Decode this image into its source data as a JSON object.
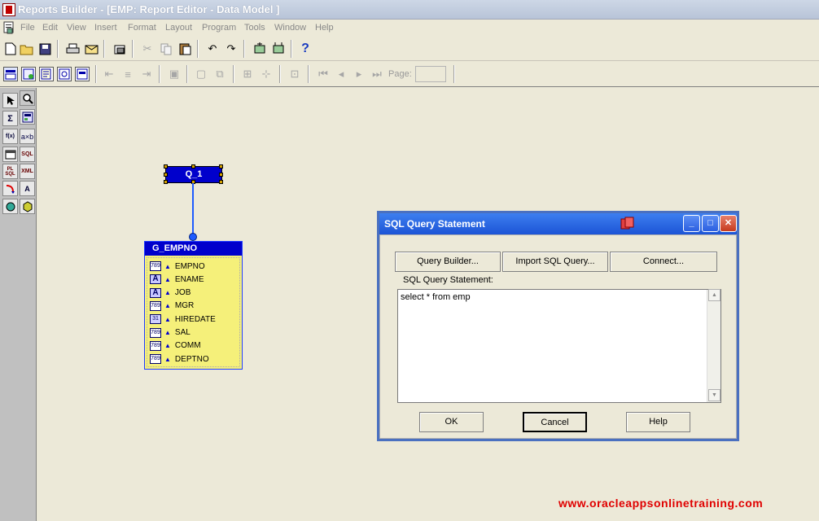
{
  "window": {
    "title": "Reports Builder - [EMP: Report Editor - Data Model ]"
  },
  "menu": [
    "File",
    "Edit",
    "View",
    "Insert",
    "Format",
    "Layout",
    "Program",
    "Tools",
    "Window",
    "Help"
  ],
  "toolbar2": {
    "page_label": "Page:"
  },
  "palette": {
    "labels": {
      "sigma": "Σ",
      "fx": "f(x)",
      "axb": "a×b",
      "sql": "SQL",
      "plsql": "PL SQL",
      "xml": "XML",
      "a": "A"
    }
  },
  "data_model": {
    "query": {
      "name": "Q_1"
    },
    "group": {
      "name": "G_EMPNO",
      "columns": [
        {
          "name": "EMPNO",
          "type": "number"
        },
        {
          "name": "ENAME",
          "type": "char"
        },
        {
          "name": "JOB",
          "type": "char"
        },
        {
          "name": "MGR",
          "type": "number"
        },
        {
          "name": "HIREDATE",
          "type": "date"
        },
        {
          "name": "SAL",
          "type": "number"
        },
        {
          "name": "COMM",
          "type": "number"
        },
        {
          "name": "DEPTNO",
          "type": "number"
        }
      ],
      "type_icons": {
        "number": "789",
        "char": "A",
        "date": "31"
      }
    }
  },
  "dialog": {
    "title": "SQL Query Statement",
    "buttons": {
      "query_builder": "Query Builder...",
      "import_sql": "Import SQL Query...",
      "connect": "Connect...",
      "ok": "OK",
      "cancel": "Cancel",
      "help": "Help"
    },
    "sql_label": "SQL Query Statement:",
    "sql_text": "select * from emp",
    "window_buttons": {
      "minimize": "_",
      "maximize": "□",
      "close": "✕"
    }
  },
  "watermark": "www.oracleappsonlinetraining.com"
}
